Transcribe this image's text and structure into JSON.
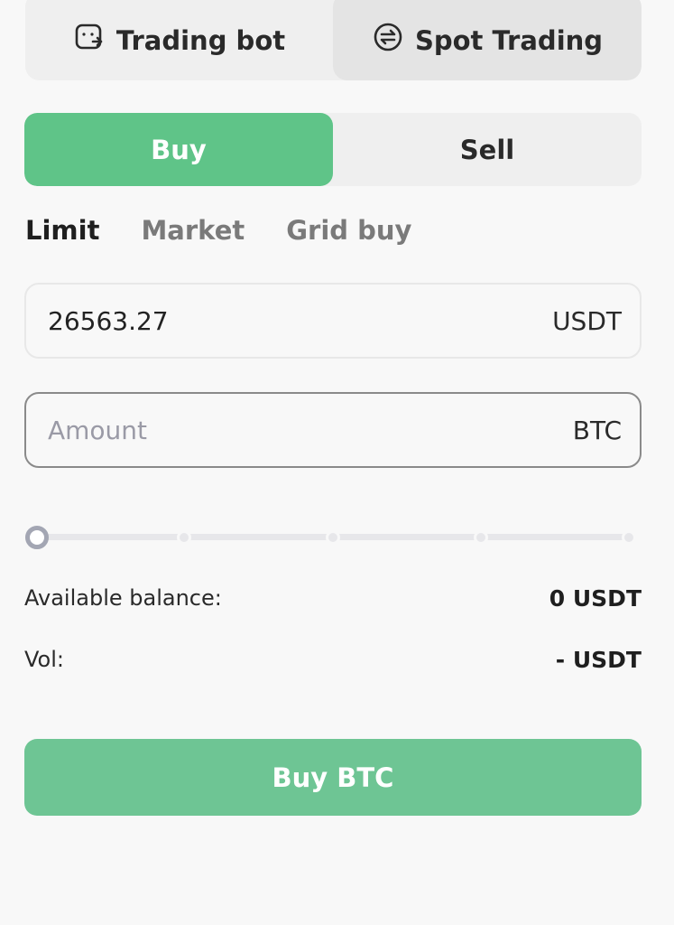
{
  "top_tabs": {
    "trading_bot": {
      "label": "Trading bot",
      "icon": "bot-face-icon"
    },
    "spot_trading": {
      "label": "Spot Trading",
      "icon": "swap-arrows-icon",
      "selected": true
    }
  },
  "side": {
    "buy_label": "Buy",
    "sell_label": "Sell",
    "selected": "Buy",
    "buy_color": "#5fc488"
  },
  "order_types": [
    "Limit",
    "Market",
    "Grid buy"
  ],
  "order_type_selected": "Limit",
  "price_field": {
    "value": "26563.27",
    "unit": "USDT"
  },
  "amount_field": {
    "value": "",
    "placeholder": "Amount",
    "unit": "BTC"
  },
  "slider": {
    "percent": 0,
    "steps": 5
  },
  "available_balance": {
    "label": "Available balance:",
    "value": "0 USDT"
  },
  "vol": {
    "label": "Vol:",
    "value": "- USDT"
  },
  "submit": {
    "label": "Buy BTC",
    "color": "#6ec594"
  }
}
